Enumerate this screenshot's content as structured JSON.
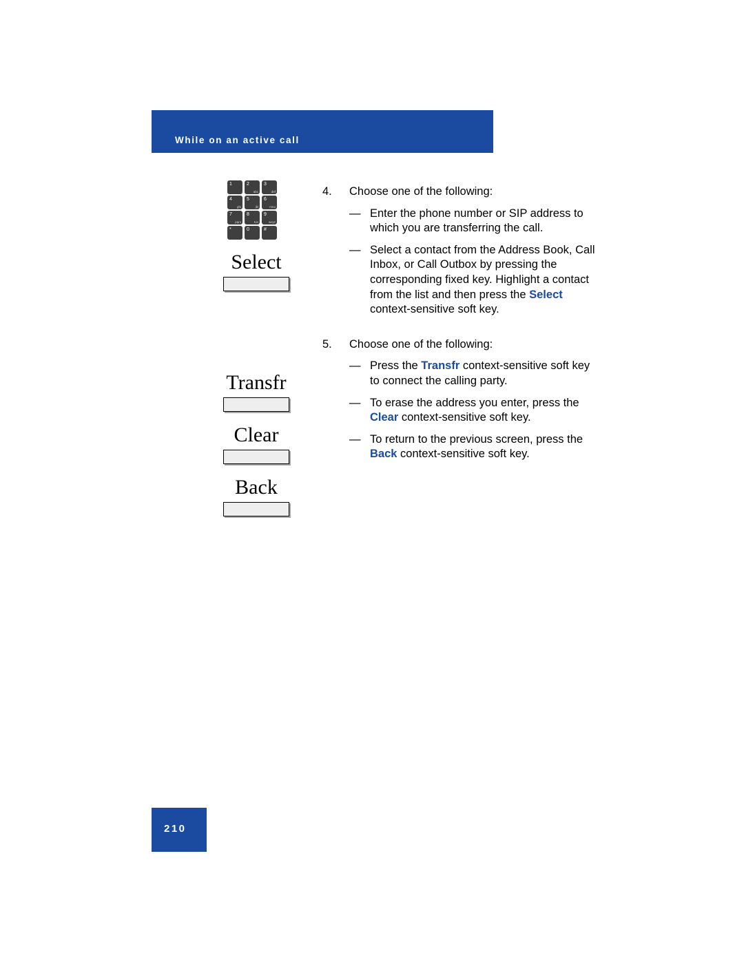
{
  "header": {
    "title": "While on an active call",
    "accent_color": "#1b4ba0"
  },
  "keypad": {
    "name": "telephone-keypad-icon",
    "keys": [
      {
        "digit": "1",
        "letters": ""
      },
      {
        "digit": "2",
        "letters": "abc"
      },
      {
        "digit": "3",
        "letters": "def"
      },
      {
        "digit": "4",
        "letters": "ghi"
      },
      {
        "digit": "5",
        "letters": "jkl"
      },
      {
        "digit": "6",
        "letters": "mno"
      },
      {
        "digit": "7",
        "letters": "pqrs"
      },
      {
        "digit": "8",
        "letters": "tuv"
      },
      {
        "digit": "9",
        "letters": "wxyz"
      },
      {
        "digit": "*",
        "letters": ""
      },
      {
        "digit": "0",
        "letters": ""
      },
      {
        "digit": "#",
        "letters": ""
      }
    ]
  },
  "softkeys": [
    {
      "label": "Select"
    },
    {
      "label": "Transfr"
    },
    {
      "label": "Clear"
    },
    {
      "label": "Back"
    }
  ],
  "steps": [
    {
      "number": "4.",
      "text": "Choose one of the following:",
      "bullets": [
        {
          "dash": "—",
          "parts": [
            {
              "text": "Enter the phone number or SIP address to which you are transferring the call.",
              "style": "plain"
            }
          ]
        },
        {
          "dash": "—",
          "parts": [
            {
              "text": "Select a contact from the Address Book, Call Inbox, or Call Outbox by pressing the corresponding fixed key.",
              "style": "plain"
            },
            {
              "text": " ",
              "style": "plain"
            },
            {
              "text": "Highlight a contact from the list and then press the ",
              "style": "plain"
            },
            {
              "text": "Select",
              "style": "keyword"
            },
            {
              "text": " context-sensitive soft key.",
              "style": "plain"
            }
          ]
        }
      ]
    },
    {
      "number": "5.",
      "text": "Choose one of the following:",
      "bullets": [
        {
          "dash": "—",
          "parts": [
            {
              "text": "Press the ",
              "style": "plain"
            },
            {
              "text": "Transfr",
              "style": "keyword"
            },
            {
              "text": " context-sensitive soft key to connect the calling party.",
              "style": "plain"
            }
          ]
        },
        {
          "dash": "—",
          "parts": [
            {
              "text": "To erase the address you enter, press the ",
              "style": "plain"
            },
            {
              "text": "Clear",
              "style": "keyword"
            },
            {
              "text": " context-sensitive soft key.",
              "style": "plain"
            }
          ]
        },
        {
          "dash": "—",
          "parts": [
            {
              "text": "To return to the previous screen, press the ",
              "style": "plain"
            },
            {
              "text": "Back",
              "style": "keyword"
            },
            {
              "text": " context-sensitive soft key.",
              "style": "plain"
            }
          ]
        }
      ]
    }
  ],
  "footer": {
    "page_number": "210"
  }
}
